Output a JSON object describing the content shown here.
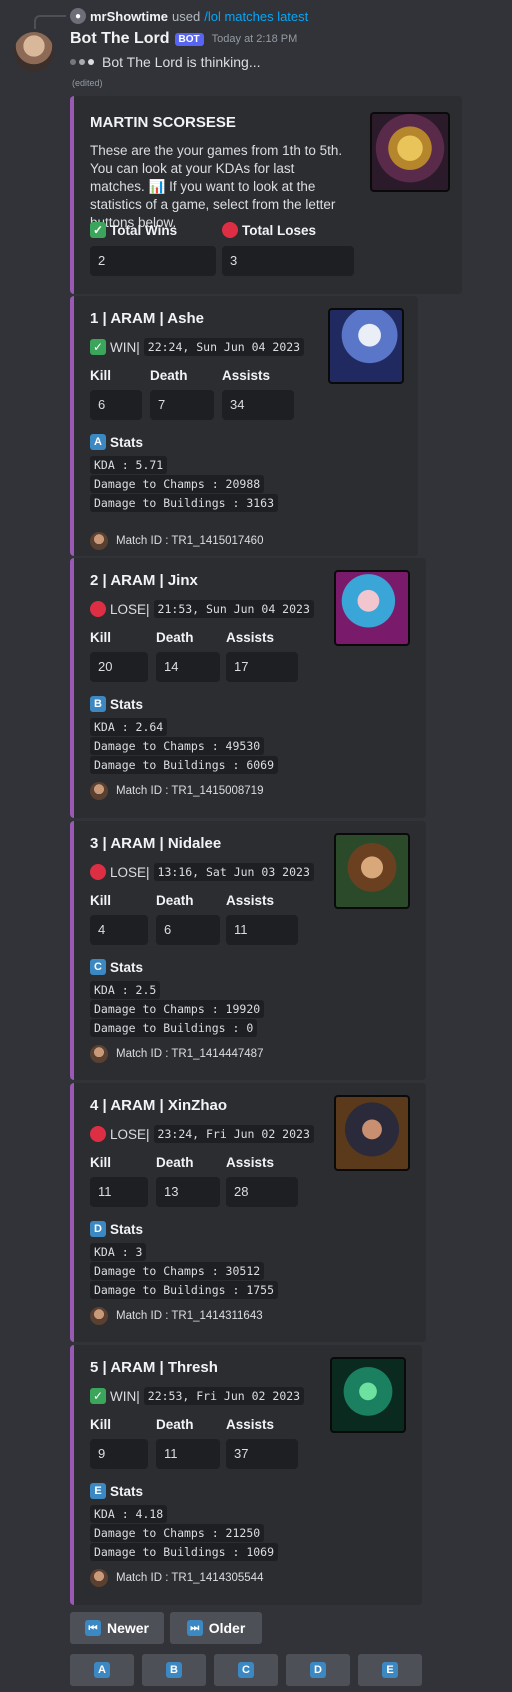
{
  "reply": {
    "user": "mrShowtime",
    "verb": "used",
    "command": "/lol matches latest"
  },
  "header": {
    "bot_name": "Bot The Lord",
    "badge": "BOT",
    "timestamp": "Today at 2:18 PM"
  },
  "thinking_text": "Bot The Lord is thinking...",
  "edited_label": "(edited)",
  "summary": {
    "title": "MARTIN SCORSESE",
    "description": "These are the your games from 1th to 5th. You can look at your KDAs for last matches. 📊 If you want to look at the statistics of a game, select from the letter buttons below.",
    "wins_label": "Total Wins",
    "wins_value": "2",
    "loses_label": "Total Loses",
    "loses_value": "3"
  },
  "labels": {
    "kill": "Kill",
    "death": "Death",
    "assists": "Assists",
    "stats": "Stats"
  },
  "matches": [
    {
      "title": "1 | ARAM | Ashe",
      "result": "WIN",
      "date": "22:24, Sun Jun 04 2023",
      "kill": "6",
      "death": "7",
      "assists": "34",
      "letter": "A",
      "kda": "KDA : 5.71",
      "dmg_champs": "Damage to Champs : 20988",
      "dmg_buildings": "Damage to Buildings : 3163",
      "match_id": "Match ID : TR1_1415017460"
    },
    {
      "title": "2 | ARAM | Jinx",
      "result": "LOSE",
      "date": "21:53, Sun Jun 04 2023",
      "kill": "20",
      "death": "14",
      "assists": "17",
      "letter": "B",
      "kda": "KDA : 2.64",
      "dmg_champs": "Damage to Champs : 49530",
      "dmg_buildings": "Damage to Buildings : 6069",
      "match_id": "Match ID : TR1_1415008719"
    },
    {
      "title": "3 | ARAM | Nidalee",
      "result": "LOSE",
      "date": "13:16, Sat Jun 03 2023",
      "kill": "4",
      "death": "6",
      "assists": "11",
      "letter": "C",
      "kda": "KDA : 2.5",
      "dmg_champs": "Damage to Champs : 19920",
      "dmg_buildings": "Damage to Buildings : 0",
      "match_id": "Match ID : TR1_1414447487"
    },
    {
      "title": "4 | ARAM | XinZhao",
      "result": "LOSE",
      "date": "23:24, Fri Jun 02 2023",
      "kill": "11",
      "death": "13",
      "assists": "28",
      "letter": "D",
      "kda": "KDA : 3",
      "dmg_champs": "Damage to Champs : 30512",
      "dmg_buildings": "Damage to Buildings : 1755",
      "match_id": "Match ID : TR1_1414311643"
    },
    {
      "title": "5 | ARAM | Thresh",
      "result": "WIN",
      "date": "22:53, Fri Jun 02 2023",
      "kill": "9",
      "death": "11",
      "assists": "37",
      "letter": "E",
      "kda": "KDA : 4.18",
      "dmg_champs": "Damage to Champs : 21250",
      "dmg_buildings": "Damage to Buildings : 1069",
      "match_id": "Match ID : TR1_1414305544"
    }
  ],
  "buttons": {
    "newer": "Newer",
    "older": "Older",
    "letters": [
      "A",
      "B",
      "C",
      "D",
      "E"
    ]
  },
  "colors": {
    "embed_accent": "#9b59b6",
    "win": "#3ba55c",
    "lose": "#dd2e44",
    "letter": "#3b88c3",
    "command": "#00a8fc",
    "bot_badge": "#5865f2"
  }
}
